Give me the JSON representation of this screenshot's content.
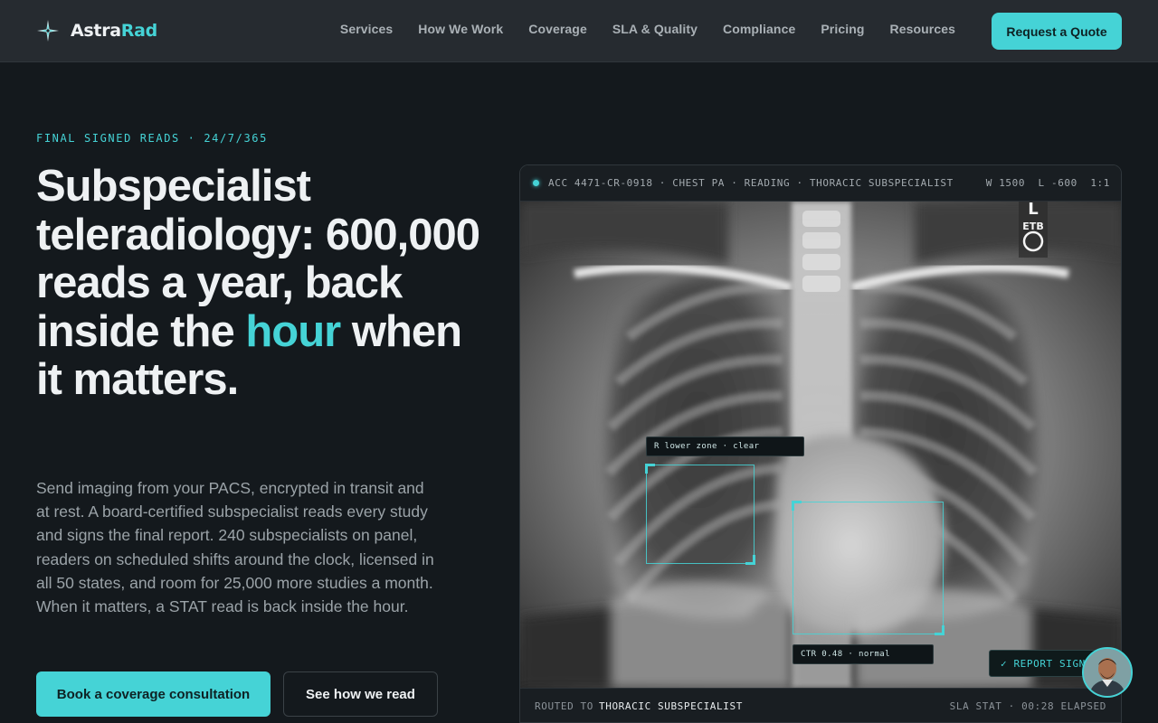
{
  "nav": {
    "brand_a": "Astra",
    "brand_b": "Rad",
    "links": [
      "Services",
      "How We Work",
      "Coverage",
      "SLA & Quality",
      "Compliance",
      "Pricing",
      "Resources"
    ],
    "cta": "Request a Quote"
  },
  "hero": {
    "eyebrow": "FINAL SIGNED READS · 24/7/365",
    "headline_pre": "Subspecialist teleradiology: 600,000 reads a year, back inside the ",
    "headline_highlight": "hour",
    "headline_post": " when it matters.",
    "lede": "Send imaging from your PACS, encrypted in transit and at rest. A board-certified subspecialist reads every study and signs the final report. 240 subspecialists on panel, readers on scheduled shifts around the clock, licensed in all 50 states, and room for 25,000 more studies a month. When it matters, a STAT read is back inside the hour.",
    "primary_cta": "Book a coverage consultation",
    "secondary_cta": "See how we read"
  },
  "viewer": {
    "study": "ACC 4471-CR-0918 · CHEST PA · READING · THORACIC SUBSPECIALIST",
    "window": "W 1500  L -600  1:1",
    "marker": "L",
    "marker_sub": "ETB",
    "annotation_1": "R lower zone · clear",
    "annotation_2": "CTR 0.48 · normal",
    "report_status": "✓ REPORT SIGNED",
    "routed_label": "ROUTED TO",
    "routed_value": "THORACIC SUBSPECIALIST",
    "sla": "SLA STAT · 00:28 ELAPSED"
  },
  "colors": {
    "accent": "#45d3d6",
    "background": "#14191d",
    "nav_bg": "#262b30"
  },
  "icons": [
    "sparkle-logo-icon",
    "check-icon",
    "live-dot-icon"
  ]
}
